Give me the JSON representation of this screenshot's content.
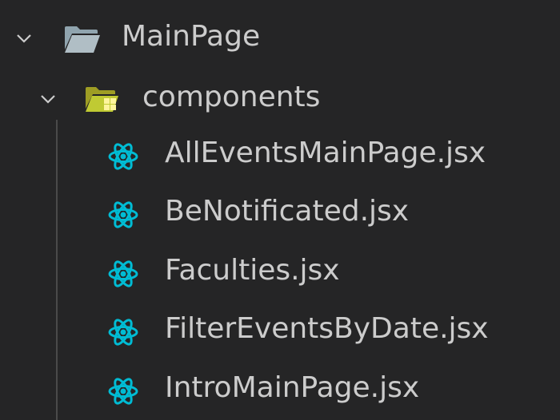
{
  "explorer": {
    "root_folder": {
      "name": "MainPage",
      "expanded": true,
      "icon": "folder-open-icon"
    },
    "sub_folder": {
      "name": "components",
      "expanded": true,
      "icon": "folder-components-icon"
    },
    "files": [
      {
        "name": "AllEventsMainPage.jsx",
        "icon": "react-icon"
      },
      {
        "name": "BeNotificated.jsx",
        "icon": "react-icon"
      },
      {
        "name": "Faculties.jsx",
        "icon": "react-icon"
      },
      {
        "name": "FilterEventsByDate.jsx",
        "icon": "react-icon"
      },
      {
        "name": "IntroMainPage.jsx",
        "icon": "react-icon"
      }
    ],
    "colors": {
      "background": "#252526",
      "text": "#cccccc",
      "react_icon": "#00bcd4",
      "folder": "#90a4ae",
      "components_folder": "#c0ca33"
    }
  }
}
